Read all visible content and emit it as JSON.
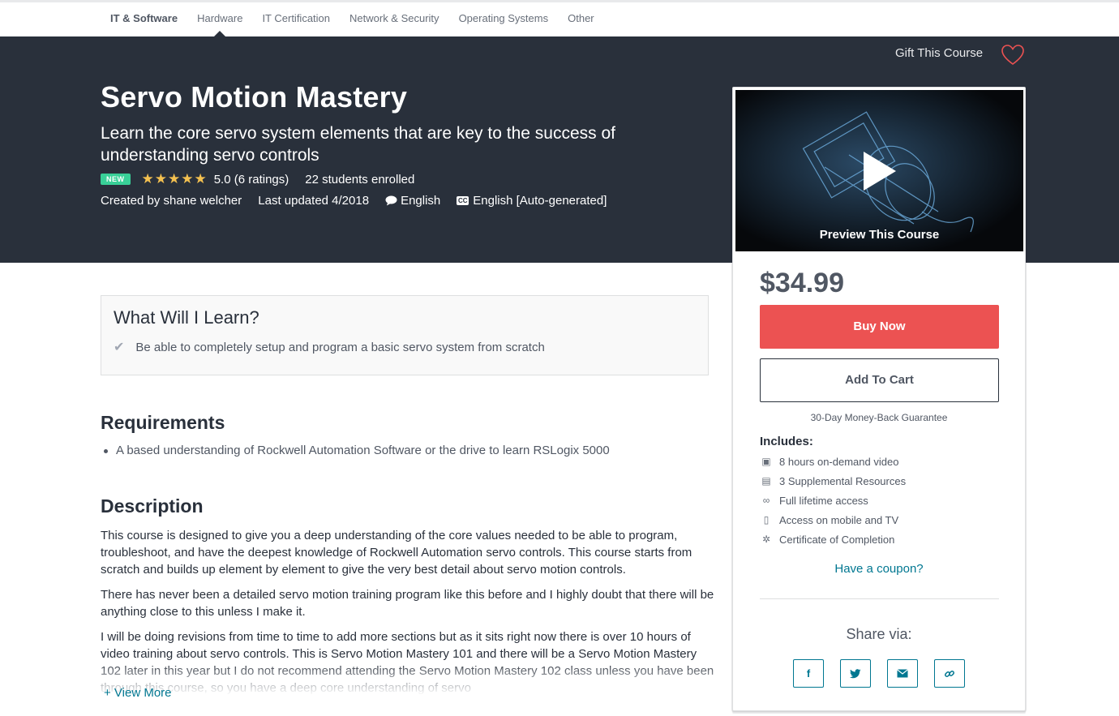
{
  "topnav": {
    "items": [
      "IT & Software",
      "Hardware",
      "IT Certification",
      "Network & Security",
      "Operating Systems",
      "Other"
    ]
  },
  "hero": {
    "gift_label": "Gift This Course",
    "title": "Servo Motion Mastery",
    "subtitle": "Learn the core servo system elements that are key to the success of understanding servo controls",
    "badge": "NEW",
    "stars": "★★★★★",
    "rating_text": "5.0 (6 ratings)",
    "enrolled": "22 students enrolled",
    "created_by": "Created by shane welcher",
    "last_updated": "Last updated 4/2018",
    "language": "English",
    "captions": "English [Auto-generated]",
    "cc_label": "CC"
  },
  "sidebar": {
    "preview_label": "Preview This Course",
    "price": "$34.99",
    "buy_label": "Buy Now",
    "cart_label": "Add To Cart",
    "guarantee": "30-Day Money-Back Guarantee",
    "includes_title": "Includes:",
    "includes": [
      {
        "icon": "video-icon",
        "text": "8 hours on-demand video"
      },
      {
        "icon": "file-icon",
        "text": "3 Supplemental Resources"
      },
      {
        "icon": "infinity-icon",
        "text": "Full lifetime access"
      },
      {
        "icon": "mobile-icon",
        "text": "Access on mobile and TV"
      },
      {
        "icon": "certificate-icon",
        "text": "Certificate of Completion"
      }
    ],
    "coupon": "Have a coupon?",
    "share_title": "Share via:",
    "share": [
      "facebook-icon",
      "twitter-icon",
      "email-icon",
      "link-icon"
    ]
  },
  "learn": {
    "title": "What Will I Learn?",
    "items": [
      "Be able to completely setup and program a basic servo system from scratch"
    ]
  },
  "requirements": {
    "title": "Requirements",
    "items": [
      "A based understanding of Rockwell Automation Software or the drive to learn RSLogix 5000"
    ]
  },
  "description": {
    "title": "Description",
    "paragraphs": [
      "This course is designed to give you a deep understanding of the core values needed to be able to program, troubleshoot, and have the deepest knowledge of Rockwell Automation servo controls. This course starts from scratch and builds up element by element to give the very best detail about servo motion controls.",
      "There has never been a detailed servo motion training program like this before and I highly doubt that there will be anything close to this unless I make it.",
      "I will be doing revisions from time to time to add more sections but as it sits right now there is over 10 hours of video training about servo controls. This is Servo Motion Mastery 101 and there will be a Servo Motion Mastery 102 later in this year but I do not recommend attending the Servo Motion Mastery 102 class unless you have been through this course, so you have a deep core understanding of servo"
    ],
    "view_more": "+ View More"
  },
  "colors": {
    "header_bg": "#29303b",
    "buy_button": "#ec5252",
    "link": "#007791",
    "badge": "#39d098",
    "stars": "#f4c150"
  }
}
